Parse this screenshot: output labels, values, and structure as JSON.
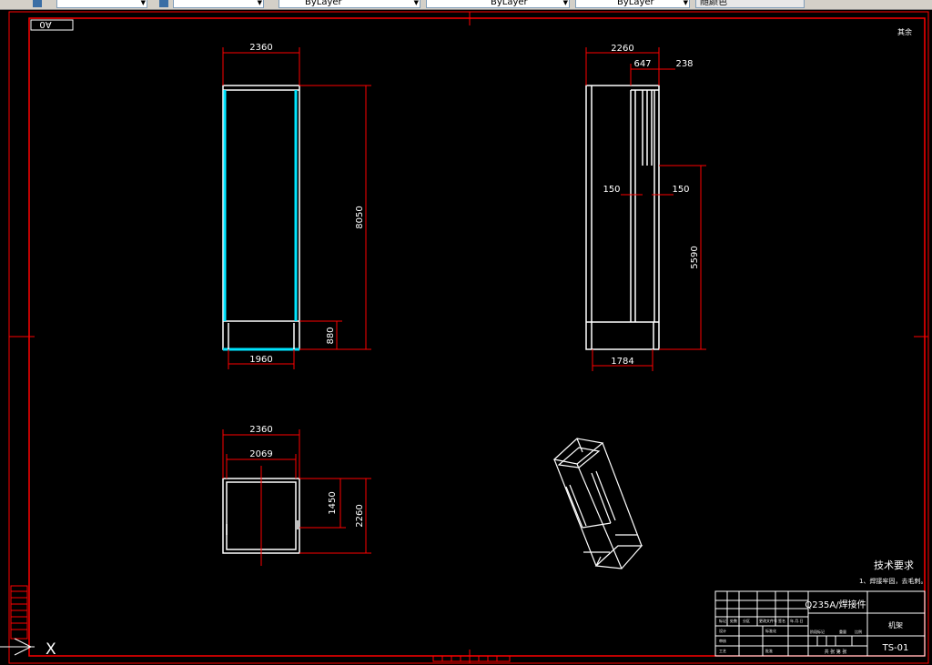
{
  "toolbar": {
    "items": [
      {
        "label": "",
        "icon": "layer-icon"
      },
      {
        "label": "",
        "icon": "style-icon"
      },
      {
        "label": "ByLayer",
        "icon": "color-icon"
      },
      {
        "label": "ByLayer"
      },
      {
        "label": "ByLayer"
      },
      {
        "label": "随颜色"
      }
    ]
  },
  "drawing": {
    "sheet_label": "A0",
    "corner_mark": "其余",
    "front_view": {
      "width_top": "2360",
      "height_total": "8050",
      "base_height": "880",
      "width_bottom": "1960"
    },
    "side_view": {
      "width_top": "2260",
      "dim_647": "647",
      "dim_238": "238",
      "dim_150_left": "150",
      "dim_150_right": "150",
      "height_5590": "5590",
      "width_bottom": "1784"
    },
    "top_view": {
      "width_outer": "2360",
      "width_inner": "2069",
      "height_1450": "1450",
      "height_2260": "2260"
    },
    "tech_req": {
      "title": "技术要求",
      "line1": "1、焊接牢固，去毛刺。"
    },
    "title_block": {
      "material": "Q235A/焊接件",
      "name": "机架",
      "drawing_no": "TS-01",
      "scale_row": "共  张  第  张",
      "labels": [
        "标记",
        "处数",
        "分区",
        "更改文件号",
        "签名",
        "年.月.日",
        "设计",
        "标准化",
        "阶段标记",
        "重量",
        "比例",
        "审核",
        "工艺",
        "批准"
      ]
    },
    "ucs_label": "X"
  },
  "colors": {
    "border": "#ff0000",
    "lines": "#ffffff",
    "cyan": "#00e5ff",
    "background": "#000000"
  }
}
